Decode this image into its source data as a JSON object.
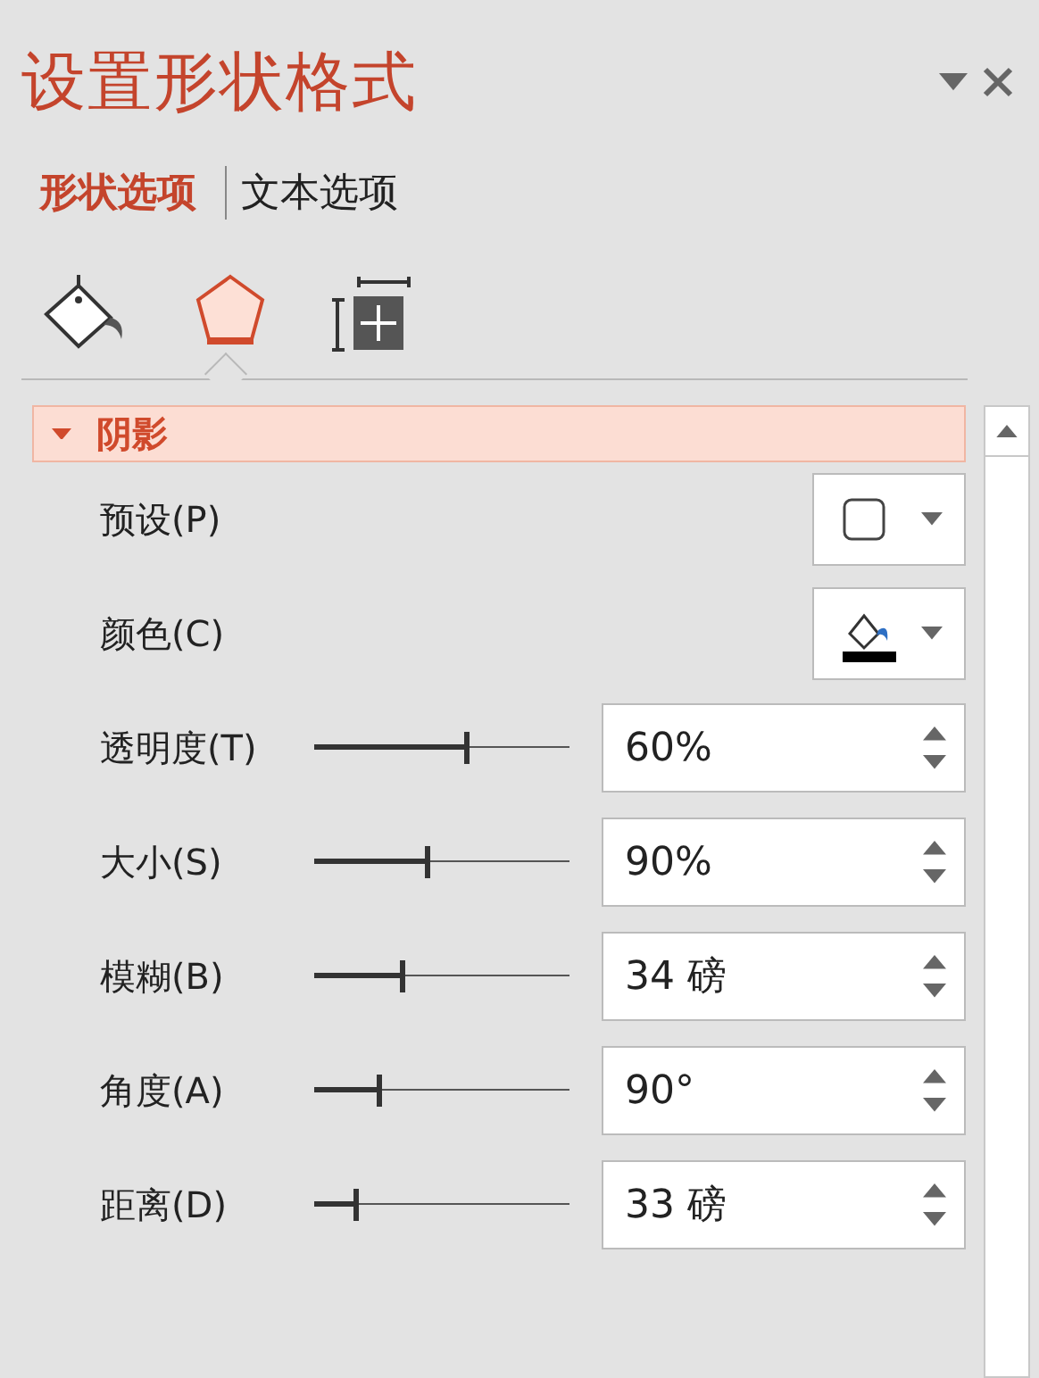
{
  "pane": {
    "title": "设置形状格式"
  },
  "tabs": [
    {
      "label": "形状选项",
      "selected": true
    },
    {
      "label": "文本选项",
      "selected": false
    }
  ],
  "icon_tabs": [
    {
      "kind": "fill",
      "selected": false
    },
    {
      "kind": "effects",
      "selected": true
    },
    {
      "kind": "size",
      "selected": false
    }
  ],
  "section": {
    "title": "阴影",
    "expanded": true
  },
  "rows": [
    {
      "kind": "dropdown",
      "label": "预设(P)",
      "swatch": {
        "kind": "preset"
      }
    },
    {
      "kind": "dropdown",
      "label": "颜色(C)",
      "swatch": {
        "kind": "color"
      }
    },
    {
      "kind": "slider",
      "label": "透明度(T)",
      "level": 0.6,
      "value": "60%"
    },
    {
      "kind": "slider",
      "label": "大小(S)",
      "level": 0.45,
      "value": "90%"
    },
    {
      "kind": "slider",
      "label": "模糊(B)",
      "level": 0.35,
      "value": "34 磅"
    },
    {
      "kind": "slider",
      "label": "角度(A)",
      "level": 0.26,
      "value": "90°"
    },
    {
      "kind": "slider",
      "label": "距离(D)",
      "level": 0.17,
      "value": "33 磅"
    }
  ]
}
